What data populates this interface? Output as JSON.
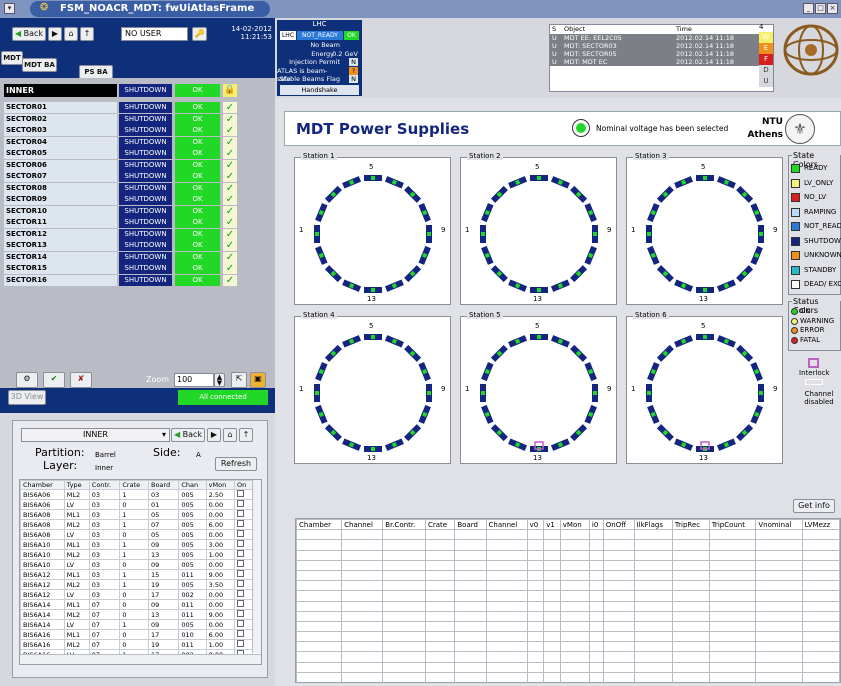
{
  "window": {
    "title": "FSM_NOACR_MDT: fwUiAtlasFrame"
  },
  "toolbar": {
    "back": "Back",
    "user": "NO USER",
    "date": "14-02-2012",
    "time": "11:21:53"
  },
  "tabs": [
    "MDT",
    "MDT BA",
    "PS BA"
  ],
  "lhc": {
    "header": "LHC",
    "lhc_label": "LHC",
    "state": "NOT_READY",
    "ok": "OK",
    "lines": [
      {
        "label": "No Beam",
        "value": ""
      },
      {
        "label": "Energy",
        "value": "0.2 GeV"
      },
      {
        "label": "Injection Permit",
        "value": "N"
      },
      {
        "label": "ATLAS is beam-safe",
        "value": "?"
      },
      {
        "label": "Stable Beams Flag",
        "value": "N"
      }
    ],
    "handshake": "Handshake"
  },
  "alerts": {
    "headers": [
      "S",
      "Object",
      "Time"
    ],
    "rows": [
      [
        "U",
        "MDT EE: EEL2C05",
        "2012.02.14 11:18"
      ],
      [
        "U",
        "MDT: SECTOR03",
        "2012.02.14 11:18"
      ],
      [
        "U",
        "MDT: SECTOR05",
        "2012.02.14 11:18"
      ],
      [
        "U",
        "MDT: MDT EC",
        "2012.02.14 11:18"
      ]
    ],
    "count": "4",
    "levels": [
      "W",
      "E",
      "F",
      "D",
      "U"
    ]
  },
  "tree": {
    "top": {
      "name": "INNER",
      "state": "SHUTDOWN",
      "status": "OK"
    },
    "sectors": [
      {
        "name": "SECTOR01",
        "state": "SHUTDOWN",
        "status": "OK"
      },
      {
        "name": "SECTOR02",
        "state": "SHUTDOWN",
        "status": "OK"
      },
      {
        "name": "SECTOR03",
        "state": "SHUTDOWN",
        "status": "OK"
      },
      {
        "name": "SECTOR04",
        "state": "SHUTDOWN",
        "status": "OK"
      },
      {
        "name": "SECTOR05",
        "state": "SHUTDOWN",
        "status": "OK"
      },
      {
        "name": "SECTOR06",
        "state": "SHUTDOWN",
        "status": "OK"
      },
      {
        "name": "SECTOR07",
        "state": "SHUTDOWN",
        "status": "OK"
      },
      {
        "name": "SECTOR08",
        "state": "SHUTDOWN",
        "status": "OK"
      },
      {
        "name": "SECTOR09",
        "state": "SHUTDOWN",
        "status": "OK"
      },
      {
        "name": "SECTOR10",
        "state": "SHUTDOWN",
        "status": "OK"
      },
      {
        "name": "SECTOR11",
        "state": "SHUTDOWN",
        "status": "OK"
      },
      {
        "name": "SECTOR12",
        "state": "SHUTDOWN",
        "status": "OK"
      },
      {
        "name": "SECTOR13",
        "state": "SHUTDOWN",
        "status": "OK"
      },
      {
        "name": "SECTOR14",
        "state": "SHUTDOWN",
        "status": "OK"
      },
      {
        "name": "SECTOR15",
        "state": "SHUTDOWN",
        "status": "OK"
      },
      {
        "name": "SECTOR16",
        "state": "SHUTDOWN",
        "status": "OK"
      }
    ]
  },
  "view": {
    "zoom_label": "Zoom",
    "zoom_value": "100",
    "view3d": "3D View",
    "connected": "All connected"
  },
  "leftbottom": {
    "select": "INNER",
    "back": "Back",
    "partition_label": "Partition:",
    "partition": "Barrel",
    "side_label": "Side:",
    "side": "A",
    "layer_label": "Layer:",
    "layer": "Inner",
    "refresh": "Refresh",
    "headers": [
      "Chamber",
      "Type",
      "Contr.",
      "Crate",
      "Board",
      "Chan",
      "vMon",
      "On"
    ],
    "rows": [
      [
        "BIS6A06",
        "ML2",
        "03",
        "1",
        "03",
        "005",
        "2.50"
      ],
      [
        "BIS6A06",
        "LV",
        "03",
        "0",
        "01",
        "005",
        "0.00"
      ],
      [
        "BIS6A08",
        "ML1",
        "03",
        "1",
        "05",
        "005",
        "0.00"
      ],
      [
        "BIS6A08",
        "ML2",
        "03",
        "1",
        "07",
        "005",
        "6.00"
      ],
      [
        "BIS6A08",
        "LV",
        "03",
        "0",
        "05",
        "005",
        "0.00"
      ],
      [
        "BIS6A10",
        "ML1",
        "03",
        "1",
        "09",
        "005",
        "3.00"
      ],
      [
        "BIS6A10",
        "ML2",
        "03",
        "1",
        "13",
        "005",
        "1.00"
      ],
      [
        "BIS6A10",
        "LV",
        "03",
        "0",
        "09",
        "005",
        "0.00"
      ],
      [
        "BIS6A12",
        "ML1",
        "03",
        "1",
        "15",
        "011",
        "9.00"
      ],
      [
        "BIS6A12",
        "ML2",
        "03",
        "1",
        "19",
        "005",
        "3.50"
      ],
      [
        "BIS6A12",
        "LV",
        "03",
        "0",
        "17",
        "002",
        "0.00"
      ],
      [
        "BIS6A14",
        "ML1",
        "07",
        "0",
        "09",
        "011",
        "0.00"
      ],
      [
        "BIS6A14",
        "ML2",
        "07",
        "0",
        "13",
        "011",
        "9.00"
      ],
      [
        "BIS6A14",
        "LV",
        "07",
        "1",
        "09",
        "005",
        "0.00"
      ],
      [
        "BIS6A16",
        "ML1",
        "07",
        "0",
        "17",
        "010",
        "6.00"
      ],
      [
        "BIS6A16",
        "ML2",
        "07",
        "0",
        "19",
        "011",
        "1.00"
      ],
      [
        "BIS6A16",
        "LV",
        "07",
        "1",
        "17",
        "002",
        "0.00"
      ]
    ]
  },
  "main": {
    "title": "MDT Power Supplies",
    "nominal": "Nominal voltage has been selected",
    "institute": "NTU Athens",
    "stations": [
      "Station 1",
      "Station 2",
      "Station 3",
      "Station 4",
      "Station 5",
      "Station 6"
    ],
    "labels": {
      "top": "5",
      "left": "1",
      "right": "9",
      "bottom": "13"
    },
    "state_legend_title": "State Colors",
    "state_legend": [
      {
        "name": "READY",
        "color": "#22d826"
      },
      {
        "name": "LV_ONLY",
        "color": "#f4f07a"
      },
      {
        "name": "NO_LV",
        "color": "#d81e1e"
      },
      {
        "name": "RAMPING",
        "color": "#b8d8f4"
      },
      {
        "name": "NOT_READY",
        "color": "#2a7ad8"
      },
      {
        "name": "SHUTDOWN",
        "color": "#13257e"
      },
      {
        "name": "UNKNOWN",
        "color": "#f09018"
      },
      {
        "name": "STANDBY",
        "color": "#28b8c8"
      },
      {
        "name": "DEAD/ EXCLUDED",
        "color": "#ffffff"
      }
    ],
    "status_legend_title": "Status Colors",
    "status_legend": [
      {
        "name": "OK",
        "color": "#22d826"
      },
      {
        "name": "WARNING",
        "color": "#f4f07a"
      },
      {
        "name": "ERROR",
        "color": "#f09018"
      },
      {
        "name": "FATAL",
        "color": "#d81e1e"
      }
    ],
    "interlock": "Interlock",
    "channel_disabled": "Channel disabled",
    "getinfo": "Get info",
    "grid_headers": [
      "Chamber",
      "Channel",
      "Br.Contr.",
      "Crate",
      "Board",
      "Channel",
      "v0",
      "v1",
      "vMon",
      "i0",
      "OnOff",
      "IlkFlags",
      "TripRec",
      "TripCount",
      "Vnominal",
      "LVMezz"
    ]
  }
}
